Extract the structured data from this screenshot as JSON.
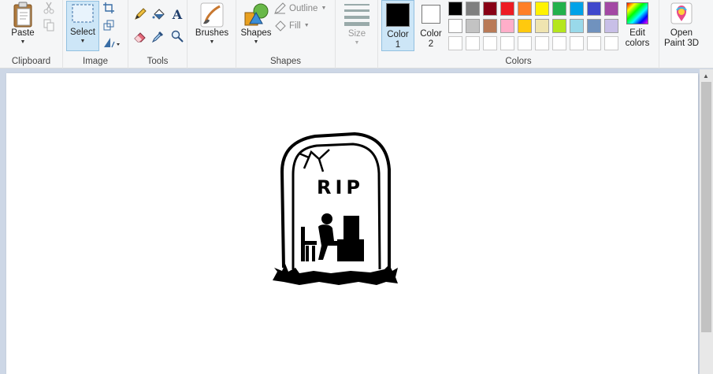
{
  "ribbon": {
    "clipboard": {
      "label": "Clipboard",
      "paste": "Paste"
    },
    "image": {
      "label": "Image",
      "select": "Select"
    },
    "tools": {
      "label": "Tools"
    },
    "brushes": {
      "label": "Brushes"
    },
    "shapes": {
      "label": "Shapes",
      "shapes_btn": "Shapes",
      "outline": "Outline",
      "fill": "Fill"
    },
    "size": {
      "label": "Size"
    },
    "colors": {
      "label": "Colors",
      "color1": "Color 1",
      "color1_num": "1",
      "color1_word": "Color",
      "color2_word": "Color",
      "color2_num": "2",
      "edit_colors_1": "Edit",
      "edit_colors_2": "colors",
      "row1": [
        "#000000",
        "#7f7f7f",
        "#880015",
        "#ed1c24",
        "#ff7f27",
        "#fff200",
        "#22b14c",
        "#00a2e8",
        "#3f48cc",
        "#a349a4"
      ],
      "row2": [
        "#ffffff",
        "#c3c3c3",
        "#b97a57",
        "#ffaec9",
        "#ffc90e",
        "#efe4b0",
        "#b5e61d",
        "#99d9ea",
        "#7092be",
        "#c8bfe7"
      ]
    },
    "paint3d": {
      "line1": "Open",
      "line2": "Paint 3D"
    }
  },
  "canvas": {
    "drawing_text": "RIP"
  }
}
